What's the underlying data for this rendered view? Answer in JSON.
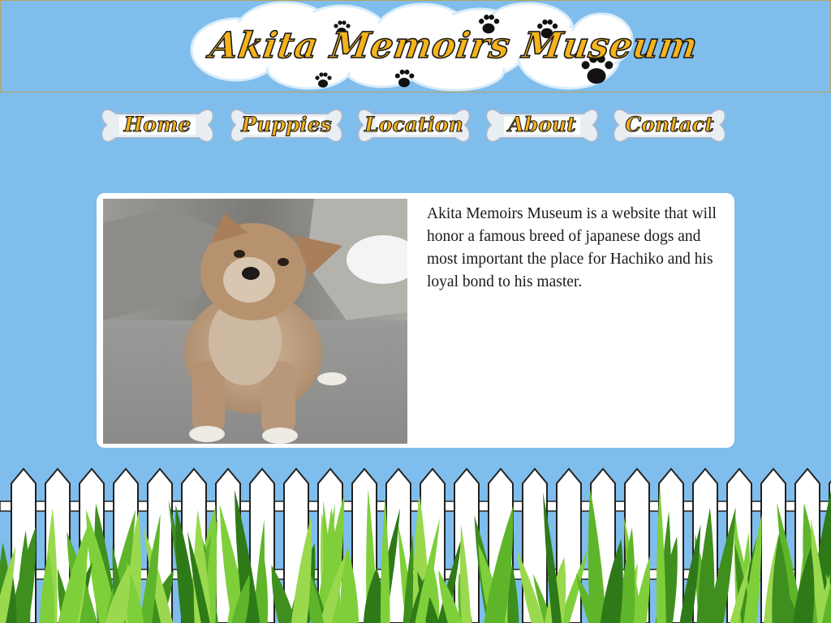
{
  "header": {
    "site_title": "Akita Memoirs Museum",
    "background_color": "#7fbdec",
    "title_color": "#f5b31c",
    "decorations": [
      "cloud-icon",
      "paw-print-icon"
    ]
  },
  "nav": {
    "items": [
      {
        "label": "Home"
      },
      {
        "label": "Puppies"
      },
      {
        "label": "Location"
      },
      {
        "label": "About"
      },
      {
        "label": "Contact"
      }
    ],
    "button_shape": "dog-bone"
  },
  "main": {
    "photo_alt_subject": "akita-puppy-photo",
    "intro_text": "Akita Memoirs Museum is a website that will honor a famous breed of japanese dogs and most important the place for Hachiko and his loyal bond to his master."
  },
  "footer": {
    "decorations": [
      "white-picket-fence",
      "grass"
    ]
  }
}
